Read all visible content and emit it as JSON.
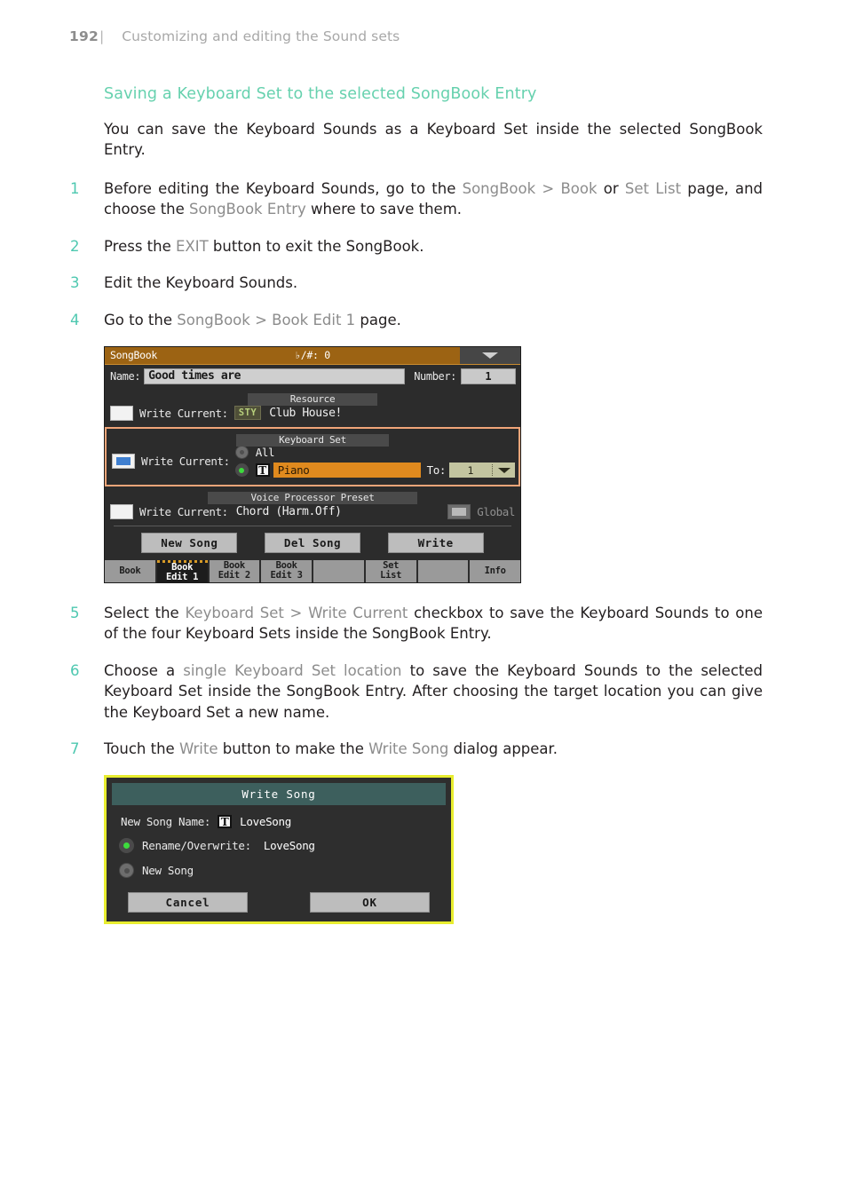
{
  "header": {
    "page_number": "192",
    "separator": "|",
    "title": "Customizing and editing the Sound sets"
  },
  "section": {
    "heading": "Saving a Keyboard Set to the selected SongBook Entry",
    "intro": "You can save the Keyboard Sounds as a Keyboard Set inside the selected SongBook Entry."
  },
  "steps": [
    {
      "num": "1",
      "parts": [
        {
          "t": "Before editing the Keyboard Sounds, go to the ",
          "ui": false
        },
        {
          "t": "SongBook > Book",
          "ui": true
        },
        {
          "t": " or ",
          "ui": false
        },
        {
          "t": "Set List",
          "ui": true
        },
        {
          "t": " page, and choose the ",
          "ui": false
        },
        {
          "t": "SongBook Entry",
          "ui": true
        },
        {
          "t": " where to save them.",
          "ui": false
        }
      ]
    },
    {
      "num": "2",
      "parts": [
        {
          "t": "Press the ",
          "ui": false
        },
        {
          "t": "EXIT",
          "ui": true
        },
        {
          "t": " button to exit the SongBook.",
          "ui": false
        }
      ]
    },
    {
      "num": "3",
      "parts": [
        {
          "t": "Edit the Keyboard Sounds.",
          "ui": false
        }
      ]
    },
    {
      "num": "4",
      "parts": [
        {
          "t": "Go to the ",
          "ui": false
        },
        {
          "t": "SongBook > Book Edit 1",
          "ui": true
        },
        {
          "t": " page.",
          "ui": false
        }
      ]
    },
    {
      "num": "5",
      "parts": [
        {
          "t": "Select the ",
          "ui": false
        },
        {
          "t": "Keyboard Set > Write Current",
          "ui": true
        },
        {
          "t": " checkbox to save the Keyboard Sounds to one of the four Keyboard Sets inside the SongBook Entry.",
          "ui": false
        }
      ]
    },
    {
      "num": "6",
      "parts": [
        {
          "t": "Choose a ",
          "ui": false
        },
        {
          "t": "single Keyboard Set location",
          "ui": true
        },
        {
          "t": " to save the Keyboard Sounds to the selected Keyboard Set inside the SongBook Entry. After choosing the target location you can give the Keyboard Set a new name.",
          "ui": false
        }
      ]
    },
    {
      "num": "7",
      "parts": [
        {
          "t": "Touch the ",
          "ui": false
        },
        {
          "t": "Write",
          "ui": true
        },
        {
          "t": " button to make the ",
          "ui": false
        },
        {
          "t": "Write Song",
          "ui": true
        },
        {
          "t": " dialog appear.",
          "ui": false
        }
      ]
    }
  ],
  "screenshot": {
    "titlebar": {
      "app_name": "SongBook",
      "key_transpose": "♭/#: 0",
      "menu_icon": "chevron-down-icon"
    },
    "name_row": {
      "name_label": "Name:",
      "name_value": "Good times are",
      "number_label": "Number:",
      "number_value": "1"
    },
    "resource": {
      "section_label": "Resource",
      "write_current_label": "Write Current:",
      "checkbox_checked": false,
      "badge": "STY",
      "value": "Club House!"
    },
    "keyboard_set": {
      "section_label": "Keyboard Set",
      "write_current_label": "Write Current:",
      "checkbox_checked": true,
      "all_label": "All",
      "all_selected": false,
      "single_selected": true,
      "text_icon": "T",
      "set_name": "Piano",
      "to_label": "To:",
      "to_value": "1",
      "highlight_color": "#f0a579"
    },
    "voice_processor": {
      "section_label": "Voice Processor Preset",
      "write_current_label": "Write Current:",
      "checkbox_checked": false,
      "value": "Chord (Harm.Off)",
      "global_label": "Global",
      "global_checked": true
    },
    "buttons": [
      {
        "label": "New Song"
      },
      {
        "label": "Del Song"
      },
      {
        "label": "Write"
      }
    ],
    "tabs": [
      {
        "line1": "Book",
        "line2": "",
        "active": false
      },
      {
        "line1": "Book",
        "line2": "Edit 1",
        "active": true
      },
      {
        "line1": "Book",
        "line2": "Edit 2",
        "active": false
      },
      {
        "line1": "Book",
        "line2": "Edit 3",
        "active": false
      },
      {
        "line1": "",
        "line2": "",
        "active": false
      },
      {
        "line1": "Set",
        "line2": "List",
        "active": false
      },
      {
        "line1": "",
        "line2": "",
        "active": false
      },
      {
        "line1": "Info",
        "line2": "",
        "active": false
      }
    ]
  },
  "dialog": {
    "title": "Write Song",
    "new_song_name_label": "New Song Name:",
    "text_icon": "T",
    "new_song_name_value": "LoveSong",
    "rename_label": "Rename/Overwrite:",
    "rename_value": "LoveSong",
    "rename_selected": true,
    "new_song_label": "New Song",
    "new_song_selected": false,
    "cancel_label": "Cancel",
    "ok_label": "OK",
    "border_color": "#e8ed2f"
  }
}
